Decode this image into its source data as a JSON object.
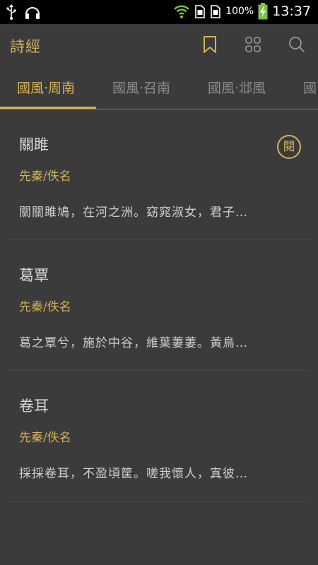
{
  "status_bar": {
    "battery_percent": "100%",
    "time": "13:37",
    "icons": [
      "usb-icon",
      "headset-icon",
      "wifi-icon",
      "sim-card-icon",
      "sim-card-icon",
      "battery-charging-icon"
    ]
  },
  "header": {
    "title": "詩經",
    "icons": [
      "bookmark-icon",
      "grid-icon",
      "search-icon"
    ]
  },
  "tabs": [
    {
      "label": "國風·周南",
      "active": true
    },
    {
      "label": "國風·召南",
      "active": false
    },
    {
      "label": "國風·邶風",
      "active": false
    },
    {
      "label": "國",
      "active": false
    }
  ],
  "poems": [
    {
      "title": "關雎",
      "author": "先秦/佚名",
      "excerpt": "關關雎鳩，在河之洲。窈窕淑女，君子…",
      "badge": "閱"
    },
    {
      "title": "葛覃",
      "author": "先秦/佚名",
      "excerpt": "葛之覃兮，施於中谷，維葉萋萋。黃鳥…",
      "badge": ""
    },
    {
      "title": "卷耳",
      "author": "先秦/佚名",
      "excerpt": "採採卷耳，不盈頃筐。嗟我懷人，寘彼…",
      "badge": ""
    }
  ],
  "colors": {
    "accent": "#d4b25a",
    "background": "#3b3b3b",
    "status_bar": "#000000",
    "wifi": "#7cc242",
    "battery": "#7cc242"
  }
}
